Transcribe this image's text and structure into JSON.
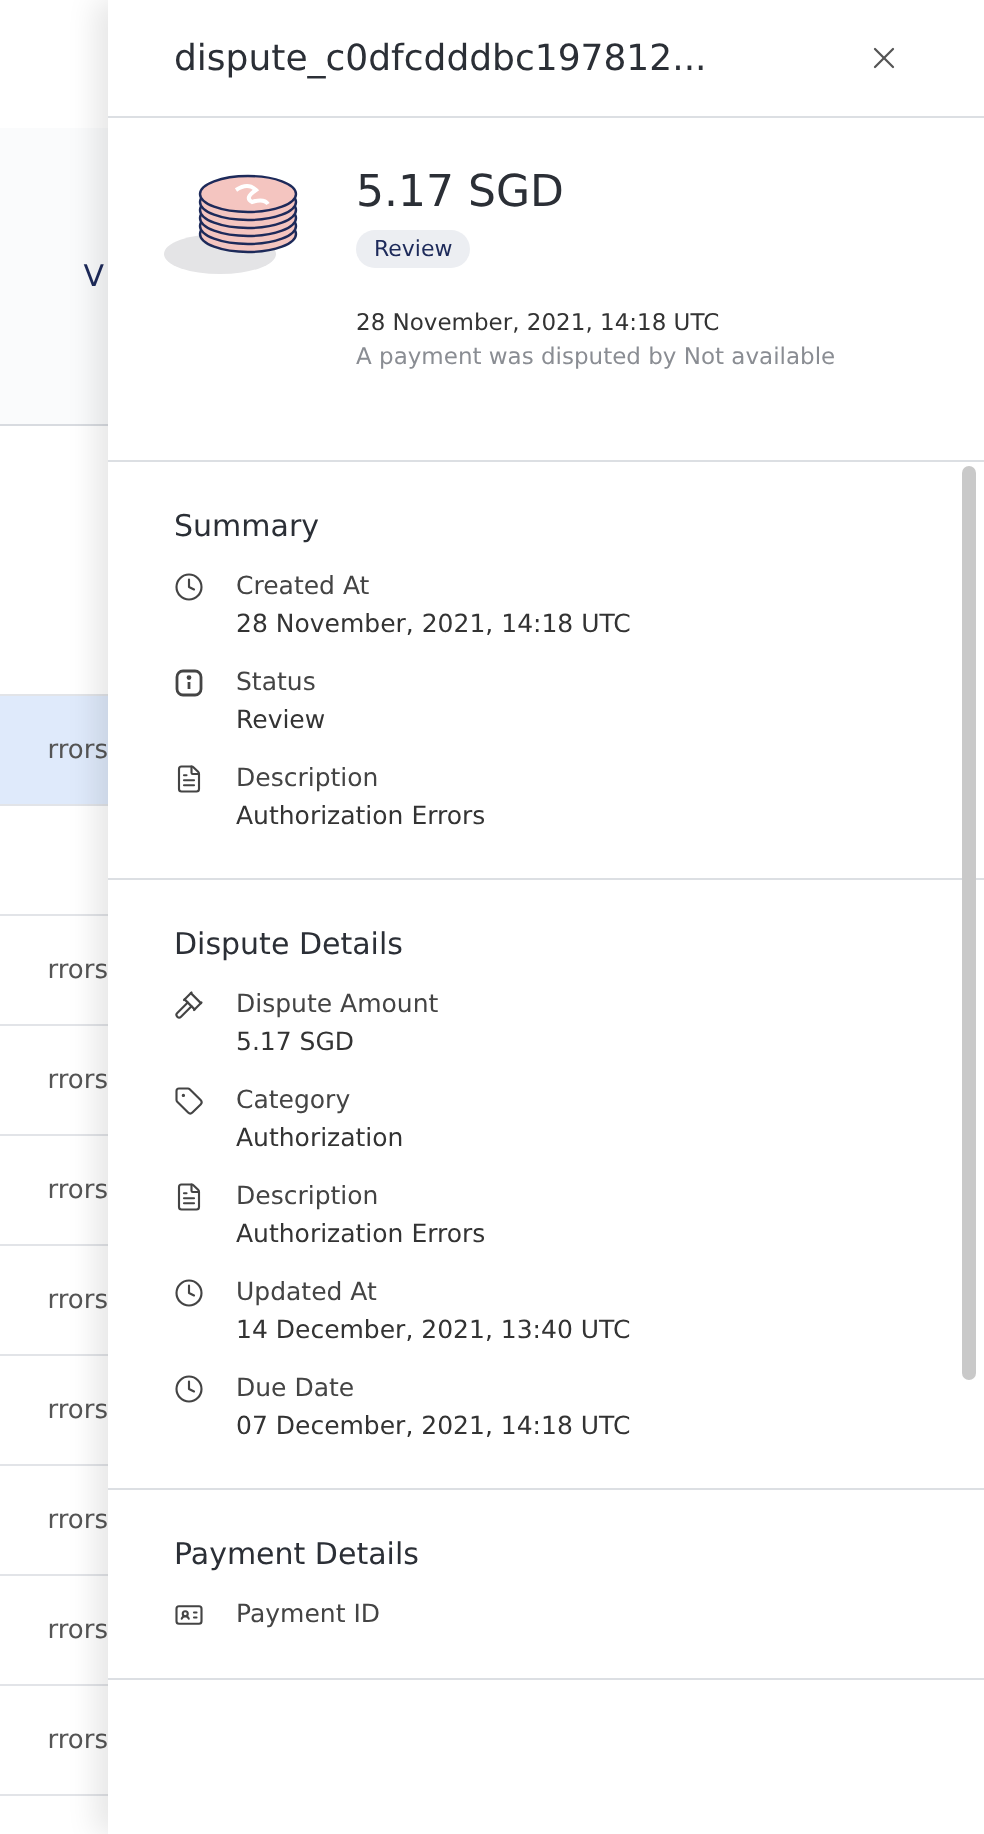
{
  "background": {
    "column_letter": "V",
    "rows": [
      {
        "text": "",
        "selected": false
      },
      {
        "text": "rrors",
        "selected": true
      },
      {
        "text": "",
        "selected": false
      },
      {
        "text": "rrors",
        "selected": false
      },
      {
        "text": "rrors",
        "selected": false
      },
      {
        "text": "rrors",
        "selected": false
      },
      {
        "text": "rrors",
        "selected": false
      },
      {
        "text": "rrors",
        "selected": false
      },
      {
        "text": "rrors",
        "selected": false
      },
      {
        "text": "rrors",
        "selected": false
      },
      {
        "text": "rrors",
        "selected": false
      }
    ]
  },
  "panel": {
    "title": "dispute_c0dfcdddbc197812...",
    "amount": "5.17 SGD",
    "status": "Review",
    "date": "28 November, 2021, 14:18 UTC",
    "note": "A payment was disputed by Not available",
    "sections": [
      {
        "heading": "Summary",
        "items": [
          {
            "kind": "time",
            "label": "Created At",
            "value": "28 November, 2021, 14:18 UTC"
          },
          {
            "kind": "status",
            "label": "Status",
            "value": "Review"
          },
          {
            "kind": "text",
            "label": "Description",
            "value": "Authorization Errors"
          }
        ]
      },
      {
        "heading": "Dispute Details",
        "items": [
          {
            "kind": "amount",
            "label": "Dispute Amount",
            "value": "5.17 SGD"
          },
          {
            "kind": "category",
            "label": "Category",
            "value": "Authorization"
          },
          {
            "kind": "text",
            "label": "Description",
            "value": "Authorization Errors"
          },
          {
            "kind": "time",
            "label": "Updated At",
            "value": "14 December, 2021, 13:40 UTC"
          },
          {
            "kind": "time",
            "label": "Due Date",
            "value": "07 December, 2021, 14:18 UTC"
          }
        ]
      },
      {
        "heading": "Payment Details",
        "items": [
          {
            "kind": "id",
            "label": "Payment ID"
          }
        ]
      }
    ]
  }
}
